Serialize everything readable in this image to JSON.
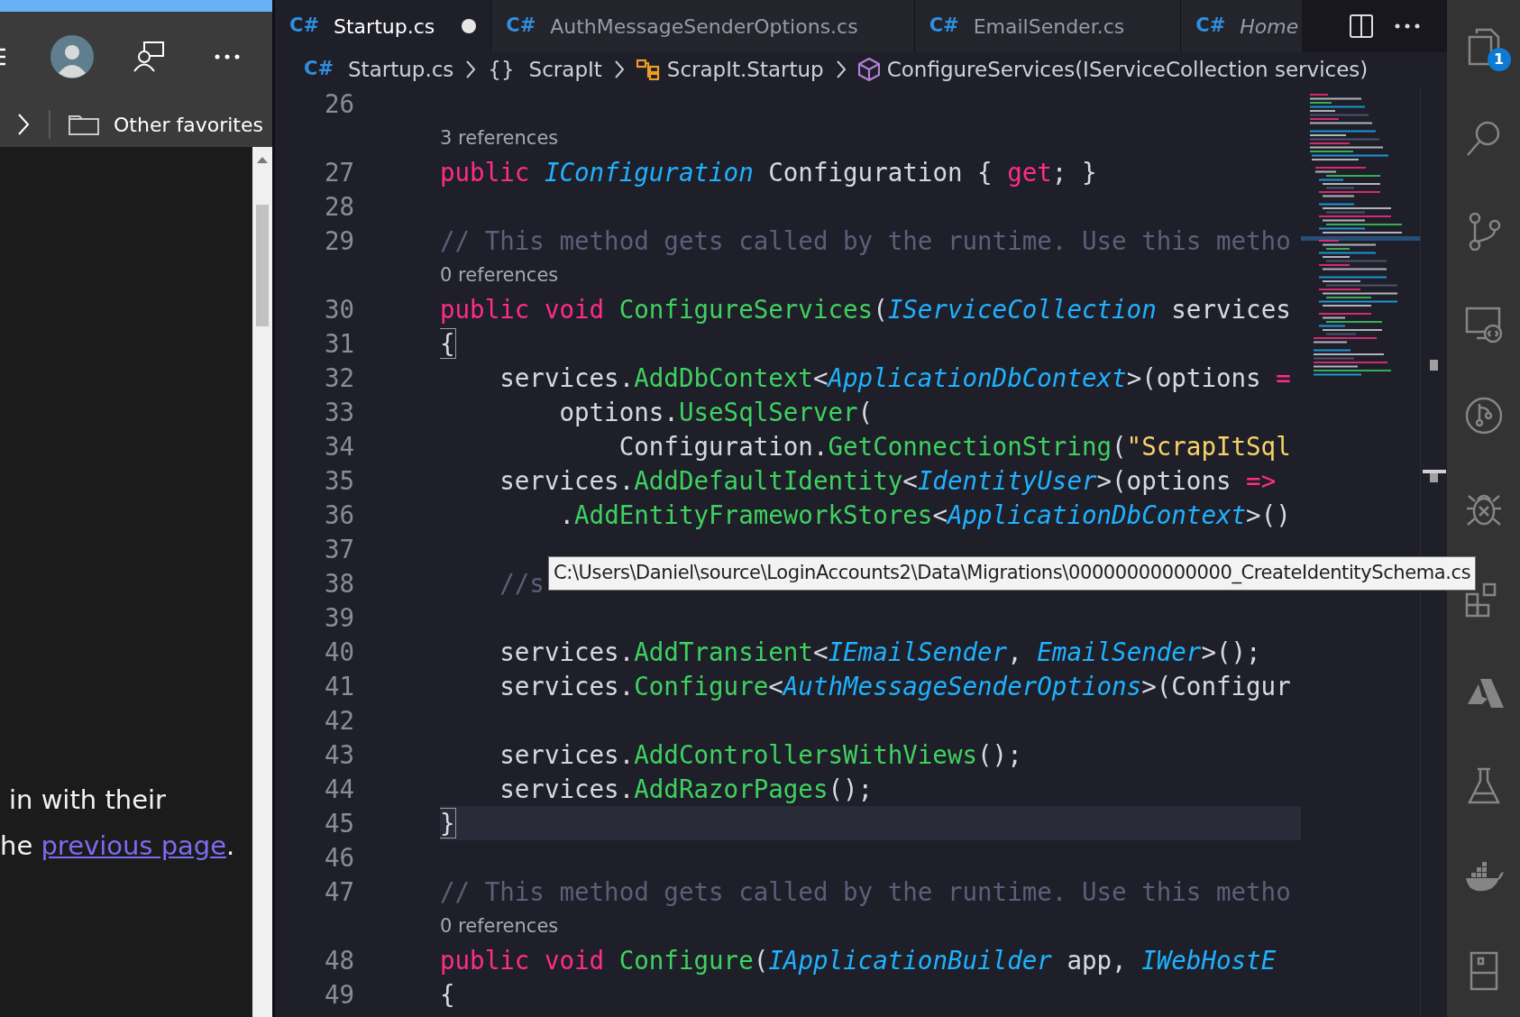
{
  "browser": {
    "favorites_bar": {
      "folder": "Other favorites"
    },
    "page_text": {
      "line_1": "in with their",
      "line_2": {
        "before": "he ",
        "link": "previous page",
        "after": "."
      }
    }
  },
  "editor": {
    "tabs": [
      {
        "icon": "C#",
        "label": "Startup.cs",
        "selected": true,
        "modified": true,
        "preview": false
      },
      {
        "icon": "C#",
        "label": "AuthMessageSenderOptions.cs",
        "selected": false,
        "modified": false,
        "preview": false
      },
      {
        "icon": "C#",
        "label": "EmailSender.cs",
        "selected": false,
        "modified": false,
        "preview": false
      },
      {
        "icon": "C#",
        "label": "Home",
        "selected": false,
        "modified": false,
        "preview": true
      }
    ],
    "breadcrumb": [
      {
        "kind": "file",
        "icon": "C#",
        "label": "Startup.cs"
      },
      {
        "kind": "namespace",
        "icon": "{}",
        "label": "ScrapIt"
      },
      {
        "kind": "class",
        "label": "ScrapIt.Startup"
      },
      {
        "kind": "method",
        "label": "ConfigureServices(IServiceCollection services)"
      }
    ],
    "lines": [
      {
        "kind": "code",
        "number": "26",
        "current": false
      },
      {
        "kind": "lens",
        "text": "3 references"
      },
      {
        "kind": "code",
        "number": "27",
        "current": false,
        "tokens": [
          {
            "kind": "keyword",
            "text": "public "
          },
          {
            "kind": "type",
            "text": "IConfiguration"
          },
          {
            "kind": "plain",
            "text": " Configuration { "
          },
          {
            "kind": "keyword",
            "text": "get"
          },
          {
            "kind": "plain",
            "text": "; }"
          }
        ]
      },
      {
        "kind": "code",
        "number": "28",
        "current": false
      },
      {
        "kind": "code",
        "number": "29",
        "current": false,
        "tokens": [
          {
            "kind": "comment",
            "text": "// This method gets called by the runtime. Use this metho"
          }
        ]
      },
      {
        "kind": "lens",
        "text": "0 references"
      },
      {
        "kind": "code",
        "number": "30",
        "current": false,
        "tokens": [
          {
            "kind": "keyword",
            "text": "public void "
          },
          {
            "kind": "method",
            "text": "ConfigureServices"
          },
          {
            "kind": "plain",
            "text": "("
          },
          {
            "kind": "type",
            "text": "IServiceCollection"
          },
          {
            "kind": "plain",
            "text": " services"
          }
        ]
      },
      {
        "kind": "code",
        "number": "31",
        "current": false,
        "tokens": [
          {
            "kind": "bracket",
            "text": "{"
          }
        ]
      },
      {
        "kind": "code",
        "number": "32",
        "current": false,
        "tokens": [
          {
            "kind": "plain",
            "text": "    services."
          },
          {
            "kind": "method",
            "text": "AddDbContext"
          },
          {
            "kind": "plain",
            "text": "<"
          },
          {
            "kind": "type",
            "text": "ApplicationDbContext"
          },
          {
            "kind": "plain",
            "text": ">(options "
          },
          {
            "kind": "operator",
            "text": "="
          }
        ]
      },
      {
        "kind": "code",
        "number": "33",
        "current": false,
        "tokens": [
          {
            "kind": "plain",
            "text": "        options."
          },
          {
            "kind": "method",
            "text": "UseSqlServer"
          },
          {
            "kind": "plain",
            "text": "("
          }
        ]
      },
      {
        "kind": "code",
        "number": "34",
        "current": false,
        "tokens": [
          {
            "kind": "plain",
            "text": "            Configuration."
          },
          {
            "kind": "method",
            "text": "GetConnectionString"
          },
          {
            "kind": "plain",
            "text": "("
          },
          {
            "kind": "string",
            "text": "\"ScrapItSql"
          }
        ]
      },
      {
        "kind": "code",
        "number": "35",
        "current": false,
        "tokens": [
          {
            "kind": "plain",
            "text": "    services."
          },
          {
            "kind": "method",
            "text": "AddDefaultIdentity"
          },
          {
            "kind": "plain",
            "text": "<"
          },
          {
            "kind": "type",
            "text": "IdentityUser"
          },
          {
            "kind": "plain",
            "text": ">(options "
          },
          {
            "kind": "operator",
            "text": "=>"
          }
        ]
      },
      {
        "kind": "code",
        "number": "36",
        "current": false,
        "tokens": [
          {
            "kind": "plain",
            "text": "        ."
          },
          {
            "kind": "method",
            "text": "AddEntityFrameworkStores"
          },
          {
            "kind": "plain",
            "text": "<"
          },
          {
            "kind": "type",
            "text": "ApplicationDbContext"
          },
          {
            "kind": "plain",
            "text": ">()"
          }
        ]
      },
      {
        "kind": "code",
        "number": "37",
        "current": false
      },
      {
        "kind": "code",
        "number": "38",
        "current": false,
        "tokens": [
          {
            "kind": "comment",
            "text": "    //s"
          }
        ]
      },
      {
        "kind": "code",
        "number": "39",
        "current": false
      },
      {
        "kind": "code",
        "number": "40",
        "current": false,
        "tokens": [
          {
            "kind": "plain",
            "text": "    services."
          },
          {
            "kind": "method",
            "text": "AddTransient"
          },
          {
            "kind": "plain",
            "text": "<"
          },
          {
            "kind": "type",
            "text": "IEmailSender"
          },
          {
            "kind": "plain",
            "text": ", "
          },
          {
            "kind": "type",
            "text": "EmailSender"
          },
          {
            "kind": "plain",
            "text": ">();"
          }
        ]
      },
      {
        "kind": "code",
        "number": "41",
        "current": false,
        "tokens": [
          {
            "kind": "plain",
            "text": "    services."
          },
          {
            "kind": "method",
            "text": "Configure"
          },
          {
            "kind": "plain",
            "text": "<"
          },
          {
            "kind": "type",
            "text": "AuthMessageSenderOptions"
          },
          {
            "kind": "plain",
            "text": ">(Configur"
          }
        ]
      },
      {
        "kind": "code",
        "number": "42",
        "current": false
      },
      {
        "kind": "code",
        "number": "43",
        "current": false,
        "tokens": [
          {
            "kind": "plain",
            "text": "    services."
          },
          {
            "kind": "method",
            "text": "AddControllersWithViews"
          },
          {
            "kind": "plain",
            "text": "();"
          }
        ]
      },
      {
        "kind": "code",
        "number": "44",
        "current": false,
        "tokens": [
          {
            "kind": "plain",
            "text": "    services."
          },
          {
            "kind": "method",
            "text": "AddRazorPages"
          },
          {
            "kind": "plain",
            "text": "();"
          }
        ]
      },
      {
        "kind": "code",
        "number": "45",
        "current": true,
        "tokens": [
          {
            "kind": "bracket",
            "text": "}"
          }
        ]
      },
      {
        "kind": "code",
        "number": "46",
        "current": false
      },
      {
        "kind": "code",
        "number": "47",
        "current": false,
        "tokens": [
          {
            "kind": "comment",
            "text": "// This method gets called by the runtime. Use this metho"
          }
        ]
      },
      {
        "kind": "lens",
        "text": "0 references"
      },
      {
        "kind": "code",
        "number": "48",
        "current": false,
        "tokens": [
          {
            "kind": "keyword",
            "text": "public void "
          },
          {
            "kind": "method",
            "text": "Configure"
          },
          {
            "kind": "plain",
            "text": "("
          },
          {
            "kind": "type",
            "text": "IApplicationBuilder"
          },
          {
            "kind": "plain",
            "text": " app, "
          },
          {
            "kind": "type",
            "text": "IWebHostE"
          }
        ]
      },
      {
        "kind": "code",
        "number": "49",
        "current": false,
        "tokens": [
          {
            "kind": "plain",
            "text": "{"
          }
        ]
      }
    ],
    "tooltip": "C:\\Users\\Daniel\\source\\LoginAccounts2\\Data\\Migrations\\00000000000000_CreateIdentitySchema.cs"
  },
  "activity_bar": {
    "explorer_badge": "1"
  }
}
